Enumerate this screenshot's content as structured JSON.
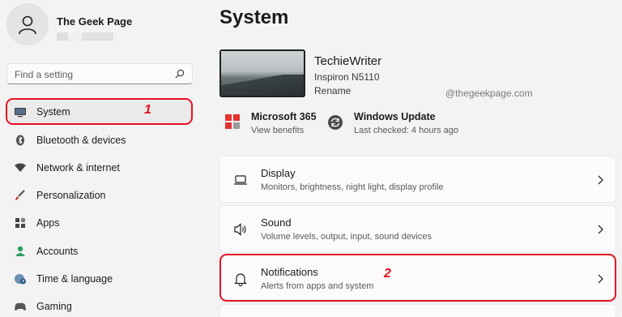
{
  "profile": {
    "name": "The Geek Page"
  },
  "search": {
    "placeholder": "Find a setting"
  },
  "sidebar": {
    "items": [
      {
        "label": "System"
      },
      {
        "label": "Bluetooth & devices"
      },
      {
        "label": "Network & internet"
      },
      {
        "label": "Personalization"
      },
      {
        "label": "Apps"
      },
      {
        "label": "Accounts"
      },
      {
        "label": "Time & language"
      },
      {
        "label": "Gaming"
      }
    ]
  },
  "annotations": {
    "step1": "1",
    "step2": "2"
  },
  "main": {
    "title": "System",
    "device": {
      "name": "TechieWriter",
      "model": "Inspiron N5110",
      "rename": "Rename"
    },
    "watermark": "@thegeekpage.com",
    "quick": [
      {
        "title": "Microsoft 365",
        "sub": "View benefits"
      },
      {
        "title": "Windows Update",
        "sub": "Last checked: 4 hours ago"
      }
    ],
    "cards": [
      {
        "title": "Display",
        "sub": "Monitors, brightness, night light, display profile"
      },
      {
        "title": "Sound",
        "sub": "Volume levels, output, input, sound devices"
      },
      {
        "title": "Notifications",
        "sub": "Alerts from apps and system"
      }
    ]
  },
  "colors": {
    "highlight": "#e81123",
    "accent": "#0067c0",
    "background": "#f3f3f3"
  }
}
